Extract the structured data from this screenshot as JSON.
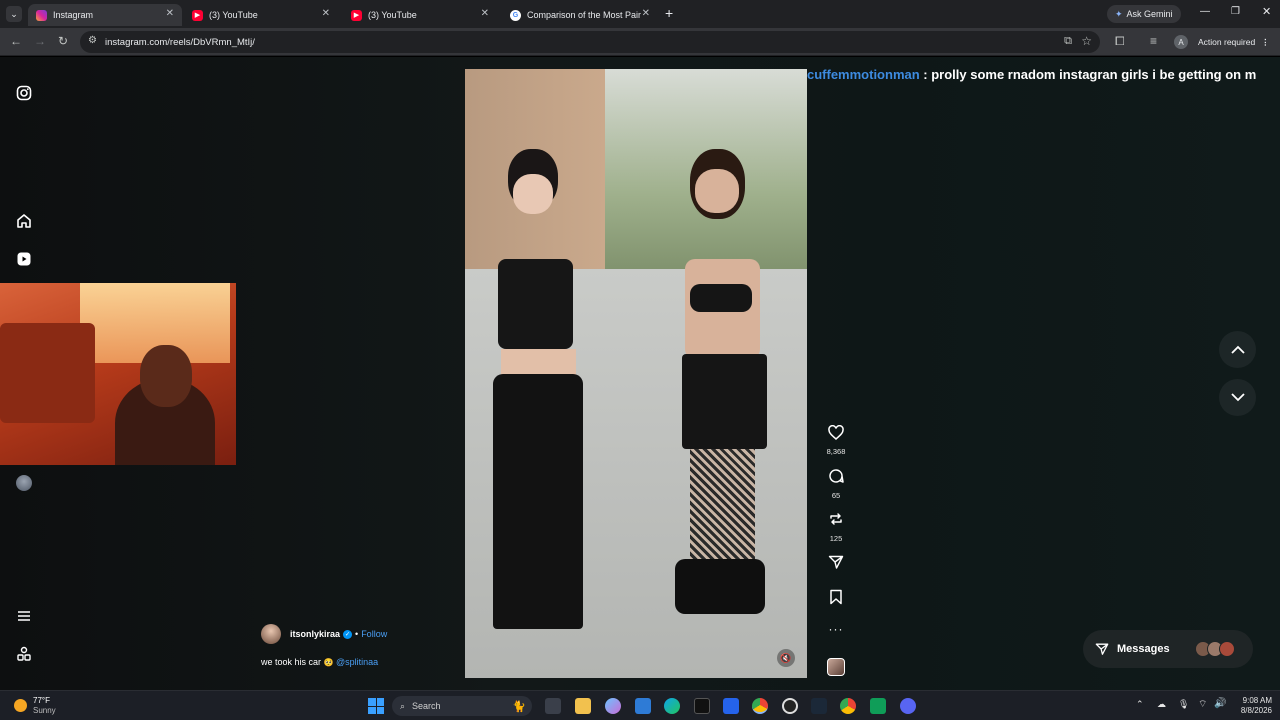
{
  "browser": {
    "tabs": [
      {
        "title": "Instagram",
        "active": true
      },
      {
        "title": "(3) YouTube",
        "active": false
      },
      {
        "title": "(3) YouTube",
        "active": false
      },
      {
        "title": "Comparison of the Most Painfu",
        "active": false
      }
    ],
    "url": "instagram.com/reels/DbVRmn_MtIj/",
    "ask_gemini": "Ask Gemini",
    "action_required": "Action required",
    "profile_initial": "A"
  },
  "chat": {
    "username": "cuffemmotionman",
    "message": " : prolly some rnadom instagran girls i be getting on m"
  },
  "reel": {
    "author": "itsonlykiraa",
    "dot": "•",
    "follow": "Follow",
    "caption_text": "we took his car",
    "caption_emoji": "🥺",
    "caption_mention": "@splitinaa",
    "likes": "8,368",
    "comments": "65",
    "reposts": "125"
  },
  "messages": {
    "label": "Messages"
  },
  "taskbar": {
    "temp": "77°F",
    "weather": "Sunny",
    "search_placeholder": "Search",
    "time": "9:08 AM",
    "date": "8/8/2026"
  },
  "colors": {
    "chat_user": "#3d8be0",
    "follow": "#4a9ff5",
    "accent": "#0095f6"
  }
}
